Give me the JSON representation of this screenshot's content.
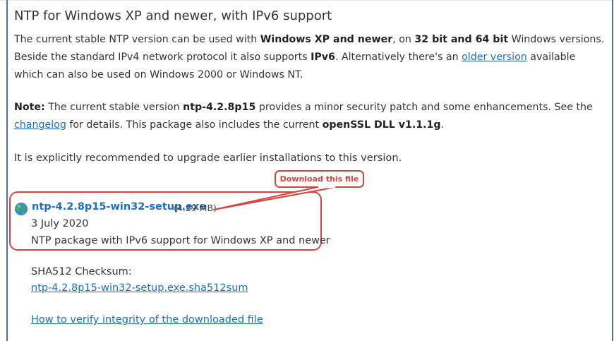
{
  "section": {
    "title": "NTP for Windows XP and newer, with IPv6 support"
  },
  "intro": {
    "t1": "The current stable NTP version can be used with ",
    "b1": "Windows XP and newer",
    "t2": ", on ",
    "b2": "32 bit and 64 bit",
    "t3": " Windows versions. Beside the standard IPv4 network protocol it also supports ",
    "b3": "IPv6",
    "t4": ". Alternatively there's an ",
    "link_older": "older version",
    "t5": " available which can also be used on Windows 2000 or Windows NT."
  },
  "note": {
    "label": "Note:",
    "t1": " The current stable version ",
    "version": "ntp-4.2.8p15",
    "t2": " provides a minor security patch and some enhancements. See the ",
    "link_changelog": "changelog",
    "t3": " for details. This package also includes the current ",
    "openssl": "openSSL DLL v1.1.1g",
    "t4": "."
  },
  "recommend": "It is explicitly recommended to upgrade earlier installations to this version.",
  "download": {
    "icon": "globe-icon",
    "filename": "ntp-4.2.8p15-win32-setup.exe",
    "size": "(4.29 MB)",
    "date": "3 July 2020",
    "description": "NTP package with IPv6 support for Windows XP and newer",
    "callout": "Download this file",
    "highlight_color": "#d9433f"
  },
  "checksum": {
    "label": "SHA512 Checksum:",
    "link": "ntp-4.2.8p15-win32-setup.exe.sha512sum"
  },
  "verify_link": "How to verify integrity of the downloaded file",
  "colors": {
    "link": "#1a6fc7",
    "frame": "#4a72b8"
  }
}
